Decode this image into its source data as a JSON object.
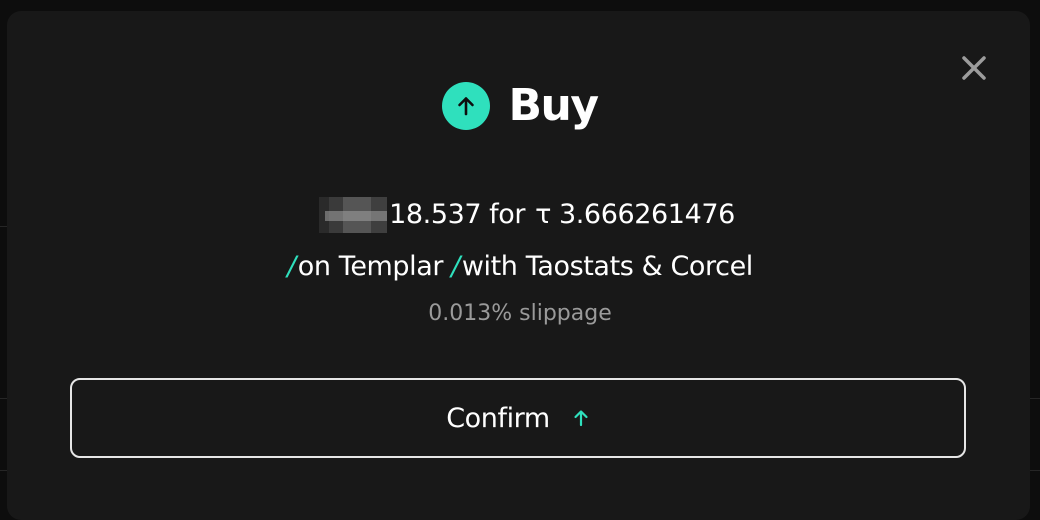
{
  "modal": {
    "title": "Buy",
    "close_icon": "close-icon",
    "buy_icon": "arrow-up-icon",
    "summary": {
      "amount": "18.537",
      "for_text": "for",
      "currency_symbol": "τ",
      "tao_amount": "3.666261476"
    },
    "route": {
      "slash": "/",
      "subnet": "on Templar",
      "provider": "with Taostats & Corcel"
    },
    "slippage": "0.013% slippage",
    "confirm_label": "Confirm",
    "confirm_icon": "arrow-up-icon"
  },
  "colors": {
    "accent": "#2fe0bd",
    "modal_bg": "#181818",
    "text": "#ffffff",
    "muted": "#9a9a9a"
  }
}
